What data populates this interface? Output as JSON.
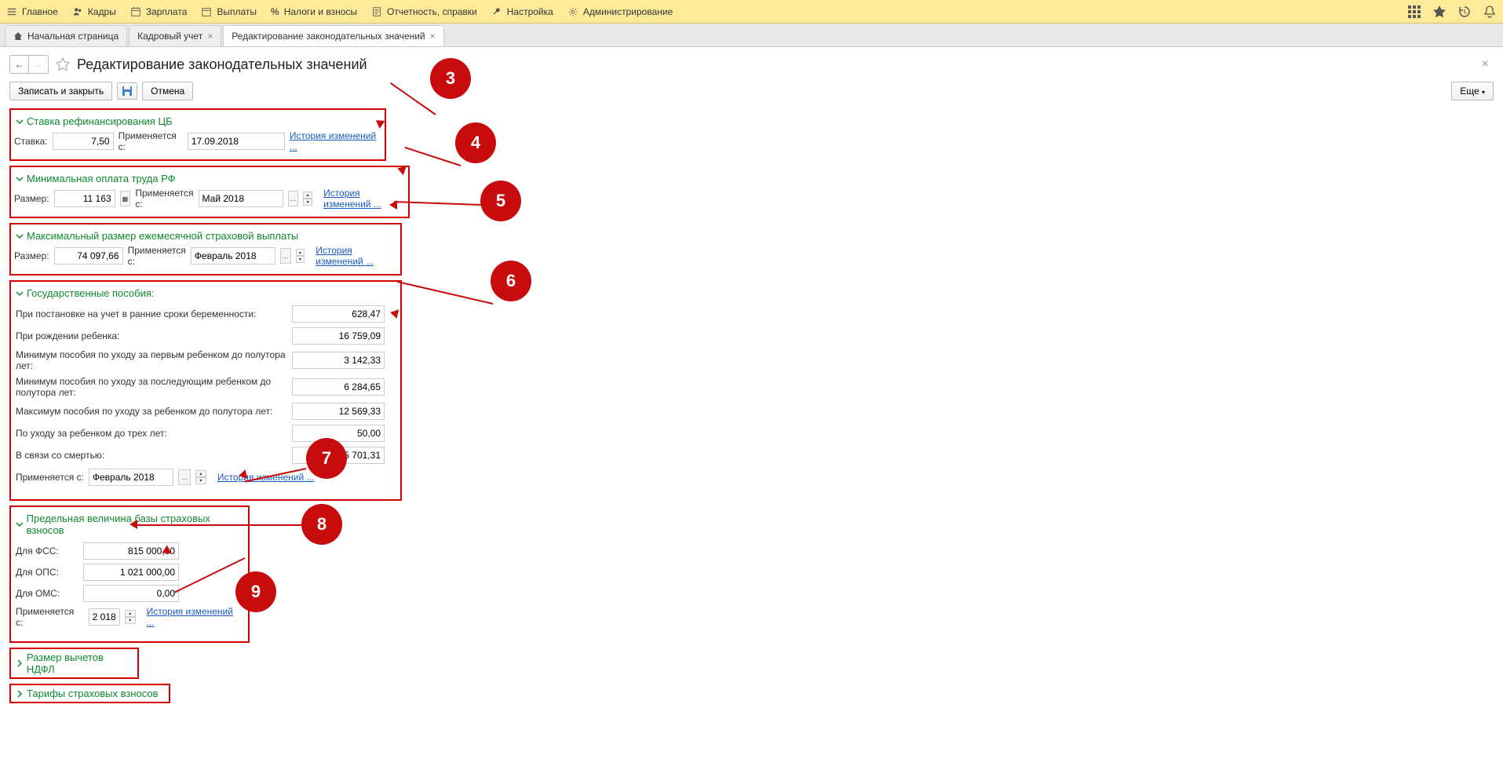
{
  "menu": {
    "main": "Главное",
    "kadry": "Кадры",
    "zarplata": "Зарплата",
    "vyplaty": "Выплаты",
    "nalogi": "Налоги и взносы",
    "otchetnost": "Отчетность, справки",
    "nastroyka": "Настройка",
    "admin": "Администрирование"
  },
  "tabs": {
    "home": "Начальная страница",
    "kadr": "Кадровый учет",
    "edit": "Редактирование законодательных значений"
  },
  "page": {
    "title": "Редактирование законодательных значений"
  },
  "toolbar": {
    "save_close": "Записать и закрыть",
    "cancel": "Отмена",
    "more": "Еще"
  },
  "callouts": {
    "c3": "3",
    "c4": "4",
    "c5": "5",
    "c6": "6",
    "c7": "7",
    "c8": "8",
    "c9": "9"
  },
  "s1": {
    "title": "Ставка рефинансирования ЦБ",
    "rate_lbl": "Ставка:",
    "rate_val": "7,50",
    "applied_lbl": "Применяется с:",
    "applied_val": "17.09.2018",
    "history": "История изменений ..."
  },
  "s2": {
    "title": "Минимальная оплата труда РФ",
    "size_lbl": "Размер:",
    "size_val": "11 163",
    "applied_lbl": "Применяется с:",
    "applied_val": "Май 2018",
    "history": "История изменений ..."
  },
  "s3": {
    "title": "Максимальный размер ежемесячной страховой выплаты",
    "size_lbl": "Размер:",
    "size_val": "74 097,66",
    "applied_lbl": "Применяется с:",
    "applied_val": "Февраль 2018",
    "history": "История изменений ..."
  },
  "s4": {
    "title": "Государственные пособия:",
    "r1_lbl": "При постановке на учет в ранние сроки беременности:",
    "r1_val": "628,47",
    "r2_lbl": "При рождении ребенка:",
    "r2_val": "16 759,09",
    "r3_lbl": "Минимум пособия по уходу за первым ребенком до полутора лет:",
    "r3_val": "3 142,33",
    "r4_lbl": "Минимум пособия по уходу за последующим ребенком до полутора лет:",
    "r4_val": "6 284,65",
    "r5_lbl": "Максимум пособия по уходу за ребенком до полутора лет:",
    "r5_val": "12 569,33",
    "r6_lbl": "По уходу за ребенком до трех лет:",
    "r6_val": "50,00",
    "r7_lbl": "В связи со смертью:",
    "r7_val": "5 701,31",
    "applied_lbl": "Применяется с:",
    "applied_val": "Февраль 2018",
    "history": "История изменений ..."
  },
  "s5": {
    "title": "Предельная величина базы страховых взносов",
    "fss_lbl": "Для ФСС:",
    "fss_val": "815 000,00",
    "ops_lbl": "Для ОПС:",
    "ops_val": "1 021 000,00",
    "oms_lbl": "Для ОМС:",
    "oms_val": "0,00",
    "applied_lbl": "Применяется с:",
    "applied_val": "2 018",
    "history": "История изменений ..."
  },
  "s6": {
    "title": "Размер вычетов НДФЛ"
  },
  "s7": {
    "title": "Тарифы страховых взносов"
  }
}
